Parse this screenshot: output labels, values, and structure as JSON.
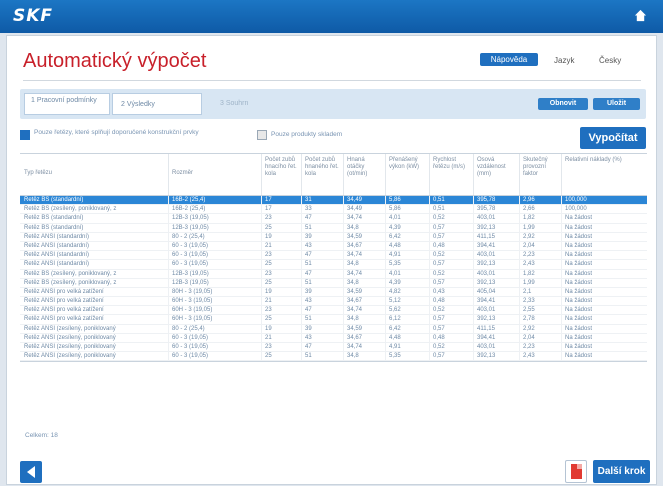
{
  "brand": {
    "logo_text": "SKF"
  },
  "header": {
    "title": "Automatický výpočet",
    "languages": [
      {
        "label": "Nápověda",
        "active": true
      },
      {
        "label": "Jazyk",
        "active": false
      },
      {
        "label": "Česky",
        "active": false
      }
    ]
  },
  "wizard": {
    "steps": [
      {
        "label": "1 Pracovní podmínky"
      },
      {
        "label": "2 Výsledky"
      },
      {
        "label": "3 Souhrn"
      }
    ],
    "actions": [
      {
        "label": "Obnovit"
      },
      {
        "label": "Uložit"
      }
    ]
  },
  "filters": {
    "only_wear_label": "Pouze řetězy, které splňují doporučené konstrukční prvky",
    "only_stock_label": "Pouze produkty skladem",
    "calculate_label": "Vypočítat"
  },
  "table": {
    "headers": [
      "Typ řetězu",
      "Rozměr",
      "Počet zubů hnacího řet. kola",
      "Počet zubů hnaného řet. kola",
      "Hnaná otáčky (ot/min)",
      "Přenášený výkon (kW)",
      "Rychlost řetězu (m/s)",
      "Osová vzdálenost (mm)",
      "Skutečný provozní faktor",
      "Relativní náklady (%)"
    ],
    "rows": [
      [
        "Řetěz BS (standardní)",
        "16B-2 (25,4)",
        "17",
        "31",
        "34,49",
        "5,86",
        "0,51",
        "395,78",
        "2,96",
        "100,000"
      ],
      [
        "Řetěz BS (zesílený, poniklovaný, z",
        "16B-2 (25,4)",
        "17",
        "33",
        "34,49",
        "5,86",
        "0,51",
        "395,78",
        "2,66",
        "100,000"
      ],
      [
        "Řetěz BS (standardní)",
        "12B-3 (19,05)",
        "23",
        "47",
        "34,74",
        "4,01",
        "0,52",
        "403,01",
        "1,82",
        "Na žádost"
      ],
      [
        "Řetěz BS (standardní)",
        "12B-3 (19,05)",
        "25",
        "51",
        "34,8",
        "4,39",
        "0,57",
        "392,13",
        "1,99",
        "Na žádost"
      ],
      [
        "Řetěz ANSI (standardní)",
        "80 - 2 (25,4)",
        "19",
        "39",
        "34,59",
        "6,42",
        "0,57",
        "411,15",
        "2,92",
        "Na žádost"
      ],
      [
        "Řetěz ANSI (standardní)",
        "60 - 3 (19,05)",
        "21",
        "43",
        "34,67",
        "4,48",
        "0,48",
        "394,41",
        "2,04",
        "Na žádost"
      ],
      [
        "Řetěz ANSI (standardní)",
        "60 - 3 (19,05)",
        "23",
        "47",
        "34,74",
        "4,91",
        "0,52",
        "403,01",
        "2,23",
        "Na žádost"
      ],
      [
        "Řetěz ANSI (standardní)",
        "60 - 3 (19,05)",
        "25",
        "51",
        "34,8",
        "5,35",
        "0,57",
        "392,13",
        "2,43",
        "Na žádost"
      ],
      [
        "Řetěz BS (zesílený, poniklovaný, z",
        "12B-3 (19,05)",
        "23",
        "47",
        "34,74",
        "4,01",
        "0,52",
        "403,01",
        "1,82",
        "Na žádost"
      ],
      [
        "Řetěz BS (zesílený, poniklovaný, z",
        "12B-3 (19,05)",
        "25",
        "51",
        "34,8",
        "4,39",
        "0,57",
        "392,13",
        "1,99",
        "Na žádost"
      ],
      [
        "Řetěz ANSI pro velká zatížení",
        "80H - 3 (19,05)",
        "19",
        "39",
        "34,59",
        "4,82",
        "0,43",
        "405,04",
        "2,1",
        "Na žádost"
      ],
      [
        "Řetěz ANSI pro velká zatížení",
        "60H - 3 (19,05)",
        "21",
        "43",
        "34,67",
        "5,12",
        "0,48",
        "394,41",
        "2,33",
        "Na žádost"
      ],
      [
        "Řetěz ANSI pro velká zatížení",
        "60H - 3 (19,05)",
        "23",
        "47",
        "34,74",
        "5,62",
        "0,52",
        "403,01",
        "2,55",
        "Na žádost"
      ],
      [
        "Řetěz ANSI pro velká zatížení",
        "60H - 3 (19,05)",
        "25",
        "51",
        "34,8",
        "6,12",
        "0,57",
        "392,13",
        "2,78",
        "Na žádost"
      ],
      [
        "Řetěz ANSI (zesílený, poniklovaný",
        "80 - 2 (25,4)",
        "19",
        "39",
        "34,59",
        "6,42",
        "0,57",
        "411,15",
        "2,92",
        "Na žádost"
      ],
      [
        "Řetěz ANSI (zesílený, poniklovaný",
        "60 - 3 (19,05)",
        "21",
        "43",
        "34,67",
        "4,48",
        "0,48",
        "394,41",
        "2,04",
        "Na žádost"
      ],
      [
        "Řetěz ANSI (zesílený, poniklovaný",
        "60 - 3 (19,05)",
        "23",
        "47",
        "34,74",
        "4,91",
        "0,52",
        "403,01",
        "2,23",
        "Na žádost"
      ],
      [
        "Řetěz ANSI (zesílený, poniklovaný",
        "60 - 3 (19,05)",
        "25",
        "51",
        "34,8",
        "5,35",
        "0,57",
        "392,13",
        "2,43",
        "Na žádost"
      ]
    ],
    "selected_row": 0
  },
  "footer": {
    "count_label": "Celkem: 18",
    "next_label": "Další krok"
  },
  "colors": {
    "accent": "#1f6fbf",
    "title": "#c8202a",
    "selected_row": "#2b86d6"
  }
}
